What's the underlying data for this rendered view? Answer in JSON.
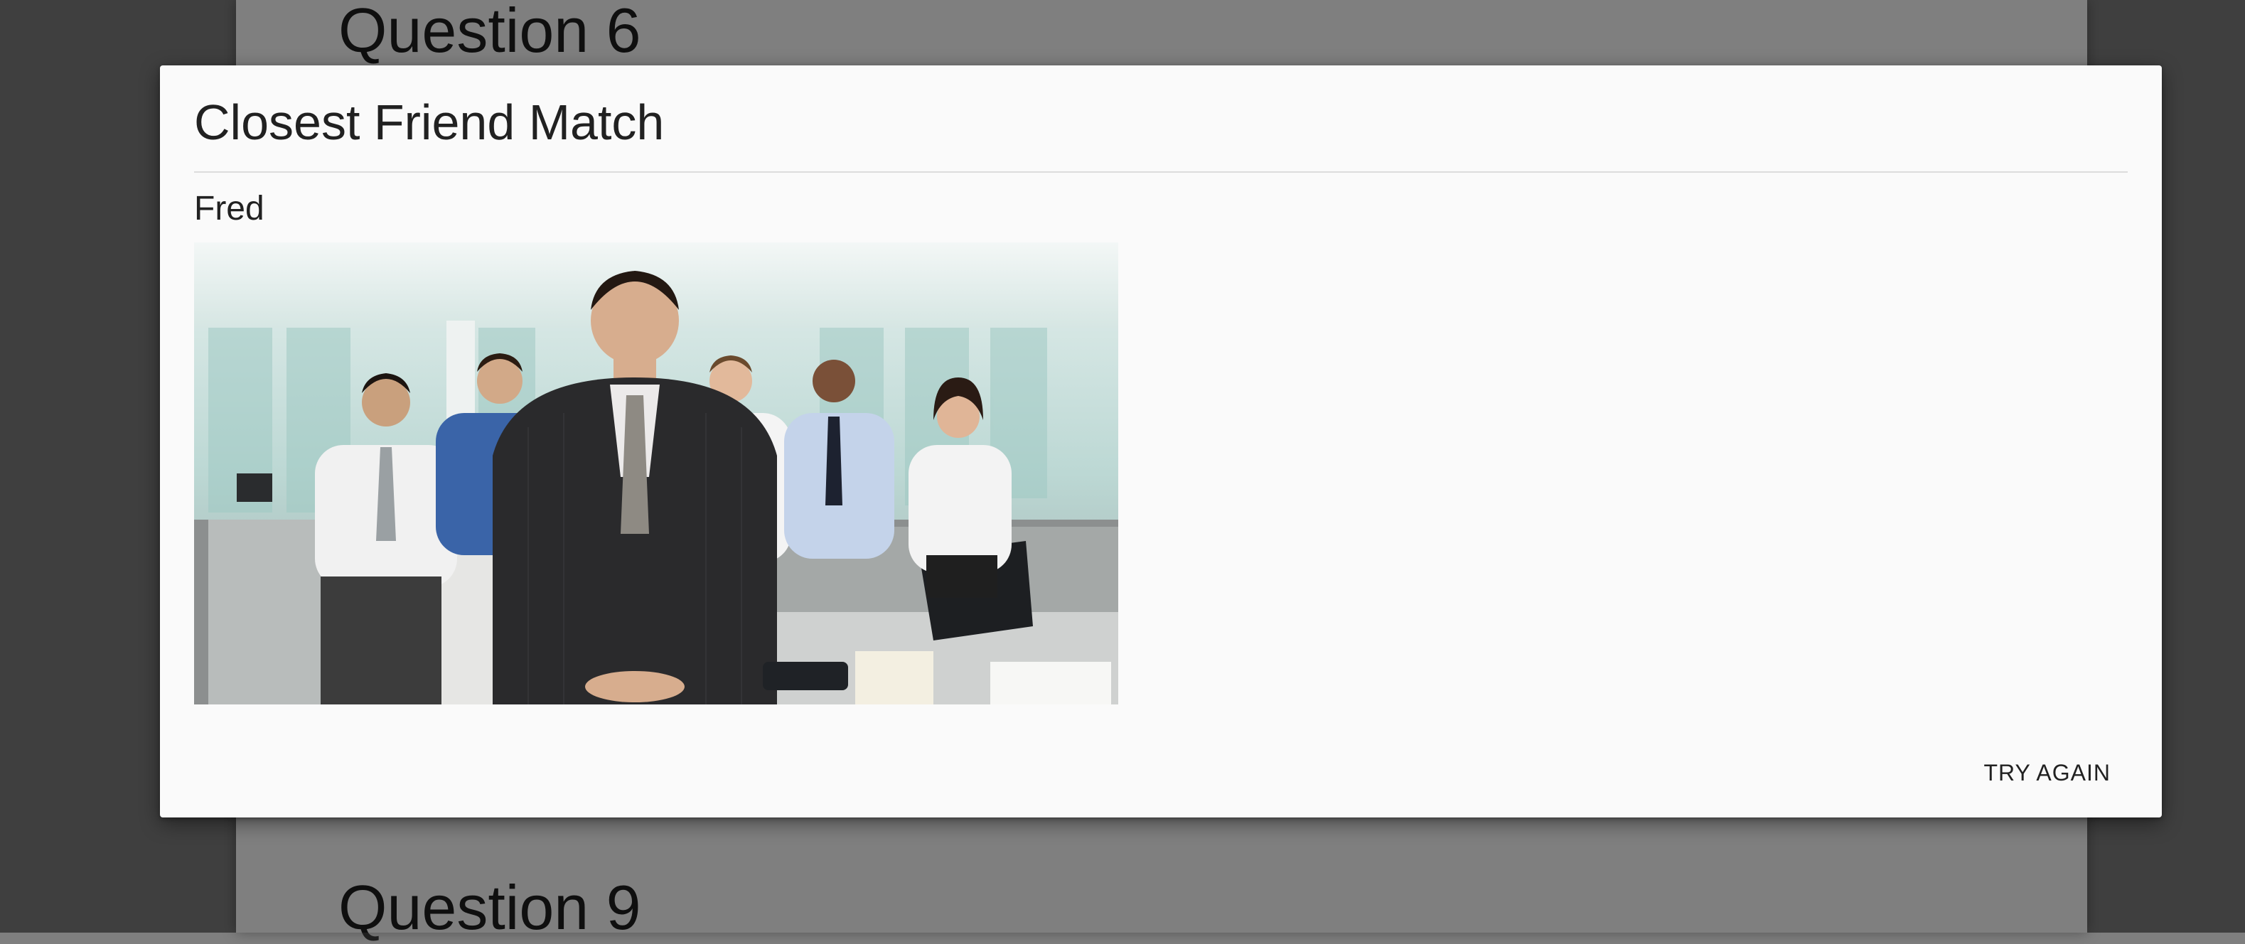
{
  "background_page": {
    "question_top": "Question 6",
    "question_bottom": "Question 9"
  },
  "dialog": {
    "title": "Closest Friend Match",
    "match_name": "Fred",
    "image_description_icon": "office-team-photo",
    "try_again_label": "TRY AGAIN"
  },
  "colors": {
    "backdrop": "#7f7f7f",
    "dialog_surface": "#fafafa",
    "text": "#212121"
  }
}
